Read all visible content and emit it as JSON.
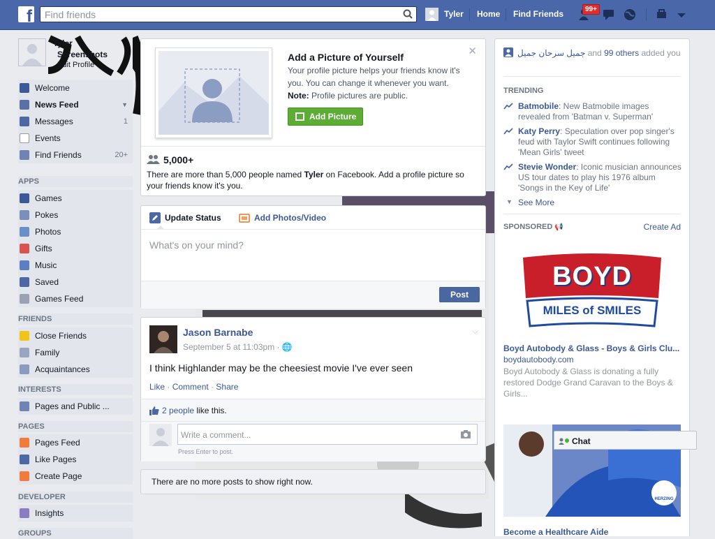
{
  "topbar": {
    "logo": "f",
    "search_placeholder": "Find friends",
    "user_name": "Tyler",
    "home": "Home",
    "find_friends": "Find Friends",
    "notif_badge": "99+"
  },
  "sidebar": {
    "profile_name": "Tyler",
    "profile_line2": "Screenshots",
    "edit_profile": "Edit Profile",
    "main_items": [
      {
        "label": "Welcome",
        "icon": "facebook-icon",
        "count": ""
      },
      {
        "label": "News Feed",
        "icon": "news-feed-icon",
        "count": ""
      },
      {
        "label": "Messages",
        "icon": "messages-icon",
        "count": "1"
      },
      {
        "label": "Events",
        "icon": "calendar-icon",
        "count": ""
      },
      {
        "label": "Find Friends",
        "icon": "find-friends-icon",
        "count": "20+"
      }
    ],
    "apps_header": "APPS",
    "apps": [
      {
        "label": "Games",
        "icon": "games-icon"
      },
      {
        "label": "Pokes",
        "icon": "pokes-icon"
      },
      {
        "label": "Photos",
        "icon": "photos-icon"
      },
      {
        "label": "Gifts",
        "icon": "gifts-icon"
      },
      {
        "label": "Music",
        "icon": "music-icon"
      },
      {
        "label": "Saved",
        "icon": "saved-icon"
      },
      {
        "label": "Games Feed",
        "icon": "games-feed-icon"
      }
    ],
    "friends_header": "FRIENDS",
    "friends": [
      {
        "label": "Close Friends",
        "icon": "star-icon"
      },
      {
        "label": "Family",
        "icon": "family-icon"
      },
      {
        "label": "Acquaintances",
        "icon": "acquaintances-icon"
      }
    ],
    "interests_header": "INTERESTS",
    "interests": [
      {
        "label": "Pages and Public ...",
        "icon": "pages-public-icon"
      }
    ],
    "pages_header": "PAGES",
    "pages": [
      {
        "label": "Pages Feed",
        "icon": "pages-feed-icon"
      },
      {
        "label": "Like Pages",
        "icon": "like-pages-icon"
      },
      {
        "label": "Create Page",
        "icon": "create-page-icon"
      }
    ],
    "developer_header": "DEVELOPER",
    "developer": [
      {
        "label": "Insights",
        "icon": "insights-icon"
      }
    ],
    "groups_header": "GROUPS"
  },
  "profile_card": {
    "title": "Add a Picture of Yourself",
    "desc": "Your profile picture helps your friends know it's you. You can change it whenever you want.",
    "note_bold": "Note:",
    "note_text": "Profile pictures are public.",
    "button": "Add Picture",
    "count": "5,000+",
    "stat_pre": "There are more than 5,000 people named",
    "stat_name": "Tyler",
    "stat_post": "on Facebook. Add a profile picture so your friends know it's you."
  },
  "composer": {
    "tab_status": "Update Status",
    "tab_photo": "Add Photos/Video",
    "placeholder": "What's on your mind?",
    "post_button": "Post"
  },
  "post": {
    "author": "Jason Barnabe",
    "time": "September 5 at 11:03pm ·",
    "text": "I think Highlander may be the cheesiest movie I've ever seen",
    "like": "Like",
    "comment": "Comment",
    "share": "Share",
    "likes_link": "2 people",
    "likes_text": "like this.",
    "comment_placeholder": "Write a comment...",
    "enter_hint": "Press Enter to post."
  },
  "no_more": "There are no more posts to show right now.",
  "right": {
    "added_name": "جميل سرحان جميل",
    "added_mid": "and",
    "added_link": "99 others",
    "added_post": "added you",
    "trending_header": "TRENDING",
    "trending": [
      {
        "name": "Batmobile",
        "text": ": New Batmobile images revealed from 'Batman v. Superman'"
      },
      {
        "name": "Katy Perry",
        "text": ": Speculation over pop singer's feud with Taylor Swift continues following 'Mean Girls' tweet"
      },
      {
        "name": "Stevie Wonder",
        "text": ": Iconic musician announces US tour dates to play his 1976 album 'Songs in the Key of Life'"
      }
    ],
    "see_more": "See More",
    "sponsored_header": "SPONSORED",
    "create_ad": "Create Ad",
    "ad1": {
      "logo_line1": "BOYD",
      "logo_line2": "MILES of SMILES",
      "title": "Boyd Autobody & Glass - Boys & Girls Clu...",
      "url": "boydautobody.com",
      "desc": "Boyd Autobody & Glass is donating a fully restored Dodge Grand Caravan to the Boys & Girls..."
    },
    "ad2_title": "Become a Healthcare Aide",
    "ad2_badge": "HERZING"
  },
  "chat": {
    "label": "Chat"
  },
  "colors": {
    "brand": "#4a67a9",
    "link": "#3b5998",
    "green": "#5cac36",
    "badge": "#e02e2e"
  }
}
